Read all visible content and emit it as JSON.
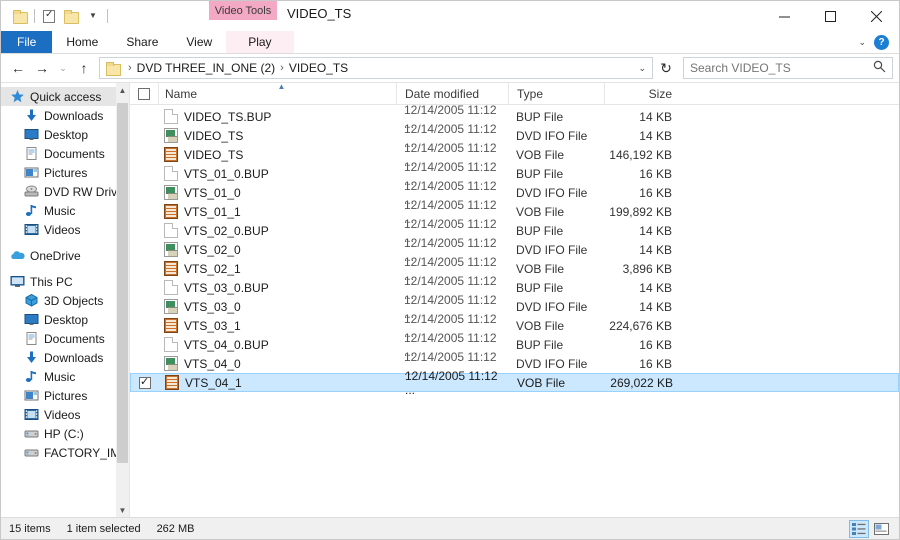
{
  "window": {
    "title": "VIDEO_TS",
    "contextual_tab_group": "Video Tools",
    "controls": {
      "minimize": "minimize-icon",
      "maximize": "maximize-icon",
      "close": "close-icon"
    }
  },
  "quick_access_toolbar": {
    "items": [
      {
        "name": "folder-icon",
        "label": ""
      },
      {
        "name": "properties-icon",
        "label": ""
      },
      {
        "name": "new-folder-icon",
        "label": ""
      },
      {
        "name": "customize-dropdown-icon",
        "label": "▾"
      }
    ]
  },
  "ribbon": {
    "tabs": [
      {
        "label": "File",
        "active": true,
        "type": "file"
      },
      {
        "label": "Home",
        "active": false,
        "type": "normal"
      },
      {
        "label": "Share",
        "active": false,
        "type": "normal"
      },
      {
        "label": "View",
        "active": false,
        "type": "normal"
      },
      {
        "label": "Play",
        "active": false,
        "type": "contextual"
      }
    ],
    "collapse_icon": "chevron-down-icon",
    "help_label": "?"
  },
  "address_bar": {
    "back_icon": "←",
    "forward_icon": "→",
    "recent_icon": "⌄",
    "up_icon": "↑",
    "breadcrumb": [
      "DVD THREE_IN_ONE (2)",
      "VIDEO_TS"
    ],
    "separator": "›",
    "dropdown_icon": "⌄",
    "refresh_icon": "↻"
  },
  "search": {
    "placeholder": "Search VIDEO_TS",
    "value": "",
    "icon": "search-icon"
  },
  "sidebar": {
    "groups": [
      {
        "items": [
          {
            "label": "Quick access",
            "icon": "star-icon",
            "indent": 0,
            "selected": true,
            "pinned": false
          },
          {
            "label": "Downloads",
            "icon": "download-icon",
            "indent": 1,
            "selected": false,
            "pinned": true
          },
          {
            "label": "Desktop",
            "icon": "desktop-icon",
            "indent": 1,
            "selected": false,
            "pinned": true
          },
          {
            "label": "Documents",
            "icon": "documents-icon",
            "indent": 1,
            "selected": false,
            "pinned": true
          },
          {
            "label": "Pictures",
            "icon": "pictures-icon",
            "indent": 1,
            "selected": false,
            "pinned": true
          },
          {
            "label": "DVD RW Drive (E",
            "icon": "disc-drive-icon",
            "indent": 1,
            "selected": false,
            "pinned": false
          },
          {
            "label": "Music",
            "icon": "music-icon",
            "indent": 1,
            "selected": false,
            "pinned": false
          },
          {
            "label": "Videos",
            "icon": "videos-icon",
            "indent": 1,
            "selected": false,
            "pinned": false
          }
        ]
      },
      {
        "items": [
          {
            "label": "OneDrive",
            "icon": "onedrive-icon",
            "indent": 0,
            "selected": false,
            "pinned": false
          }
        ]
      },
      {
        "items": [
          {
            "label": "This PC",
            "icon": "this-pc-icon",
            "indent": 0,
            "selected": false,
            "pinned": false
          },
          {
            "label": "3D Objects",
            "icon": "3d-objects-icon",
            "indent": 1,
            "selected": false,
            "pinned": false
          },
          {
            "label": "Desktop",
            "icon": "desktop-icon",
            "indent": 1,
            "selected": false,
            "pinned": false
          },
          {
            "label": "Documents",
            "icon": "documents-icon",
            "indent": 1,
            "selected": false,
            "pinned": false
          },
          {
            "label": "Downloads",
            "icon": "download-icon",
            "indent": 1,
            "selected": false,
            "pinned": false
          },
          {
            "label": "Music",
            "icon": "music-icon",
            "indent": 1,
            "selected": false,
            "pinned": false
          },
          {
            "label": "Pictures",
            "icon": "pictures-icon",
            "indent": 1,
            "selected": false,
            "pinned": false
          },
          {
            "label": "Videos",
            "icon": "videos-icon",
            "indent": 1,
            "selected": false,
            "pinned": false
          },
          {
            "label": "HP (C:)",
            "icon": "hard-drive-icon",
            "indent": 1,
            "selected": false,
            "pinned": false
          },
          {
            "label": "FACTORY_IMAG",
            "icon": "hard-drive-icon",
            "indent": 1,
            "selected": false,
            "pinned": false
          }
        ]
      }
    ]
  },
  "file_list": {
    "columns": [
      {
        "key": "name",
        "label": "Name",
        "sorted": "asc"
      },
      {
        "key": "date",
        "label": "Date modified",
        "sorted": ""
      },
      {
        "key": "type",
        "label": "Type",
        "sorted": ""
      },
      {
        "key": "size",
        "label": "Size",
        "sorted": ""
      }
    ],
    "rows": [
      {
        "name": "VIDEO_TS.BUP",
        "date": "12/14/2005 11:12 ...",
        "type": "BUP File",
        "size": "14 KB",
        "icon": "bup",
        "selected": false,
        "checked": false
      },
      {
        "name": "VIDEO_TS",
        "date": "12/14/2005 11:12 ...",
        "type": "DVD IFO File",
        "size": "14 KB",
        "icon": "ifo",
        "selected": false,
        "checked": false
      },
      {
        "name": "VIDEO_TS",
        "date": "12/14/2005 11:12 ...",
        "type": "VOB File",
        "size": "146,192 KB",
        "icon": "vob",
        "selected": false,
        "checked": false
      },
      {
        "name": "VTS_01_0.BUP",
        "date": "12/14/2005 11:12 ...",
        "type": "BUP File",
        "size": "16 KB",
        "icon": "bup",
        "selected": false,
        "checked": false
      },
      {
        "name": "VTS_01_0",
        "date": "12/14/2005 11:12 ...",
        "type": "DVD IFO File",
        "size": "16 KB",
        "icon": "ifo",
        "selected": false,
        "checked": false
      },
      {
        "name": "VTS_01_1",
        "date": "12/14/2005 11:12 ...",
        "type": "VOB File",
        "size": "199,892 KB",
        "icon": "vob",
        "selected": false,
        "checked": false
      },
      {
        "name": "VTS_02_0.BUP",
        "date": "12/14/2005 11:12 ...",
        "type": "BUP File",
        "size": "14 KB",
        "icon": "bup",
        "selected": false,
        "checked": false
      },
      {
        "name": "VTS_02_0",
        "date": "12/14/2005 11:12 ...",
        "type": "DVD IFO File",
        "size": "14 KB",
        "icon": "ifo",
        "selected": false,
        "checked": false
      },
      {
        "name": "VTS_02_1",
        "date": "12/14/2005 11:12 ...",
        "type": "VOB File",
        "size": "3,896 KB",
        "icon": "vob",
        "selected": false,
        "checked": false
      },
      {
        "name": "VTS_03_0.BUP",
        "date": "12/14/2005 11:12 ...",
        "type": "BUP File",
        "size": "14 KB",
        "icon": "bup",
        "selected": false,
        "checked": false
      },
      {
        "name": "VTS_03_0",
        "date": "12/14/2005 11:12 ...",
        "type": "DVD IFO File",
        "size": "14 KB",
        "icon": "ifo",
        "selected": false,
        "checked": false
      },
      {
        "name": "VTS_03_1",
        "date": "12/14/2005 11:12 ...",
        "type": "VOB File",
        "size": "224,676 KB",
        "icon": "vob",
        "selected": false,
        "checked": false
      },
      {
        "name": "VTS_04_0.BUP",
        "date": "12/14/2005 11:12 ...",
        "type": "BUP File",
        "size": "16 KB",
        "icon": "bup",
        "selected": false,
        "checked": false
      },
      {
        "name": "VTS_04_0",
        "date": "12/14/2005 11:12 ...",
        "type": "DVD IFO File",
        "size": "16 KB",
        "icon": "ifo",
        "selected": false,
        "checked": false
      },
      {
        "name": "VTS_04_1",
        "date": "12/14/2005 11:12 ...",
        "type": "VOB File",
        "size": "269,022 KB",
        "icon": "vob",
        "selected": true,
        "checked": true
      }
    ]
  },
  "status_bar": {
    "item_count": "15 items",
    "selection": "1 item selected",
    "selection_size": "262 MB",
    "views": [
      {
        "name": "details-view-button",
        "active": true
      },
      {
        "name": "large-icons-view-button",
        "active": false
      }
    ]
  },
  "colors": {
    "accent": "#1b6ec2",
    "contextual_tab": "#f3a9c4",
    "contextual_tab_light": "#fdeef4",
    "selection": "#cce8ff",
    "selection_border": "#99d1ff"
  }
}
